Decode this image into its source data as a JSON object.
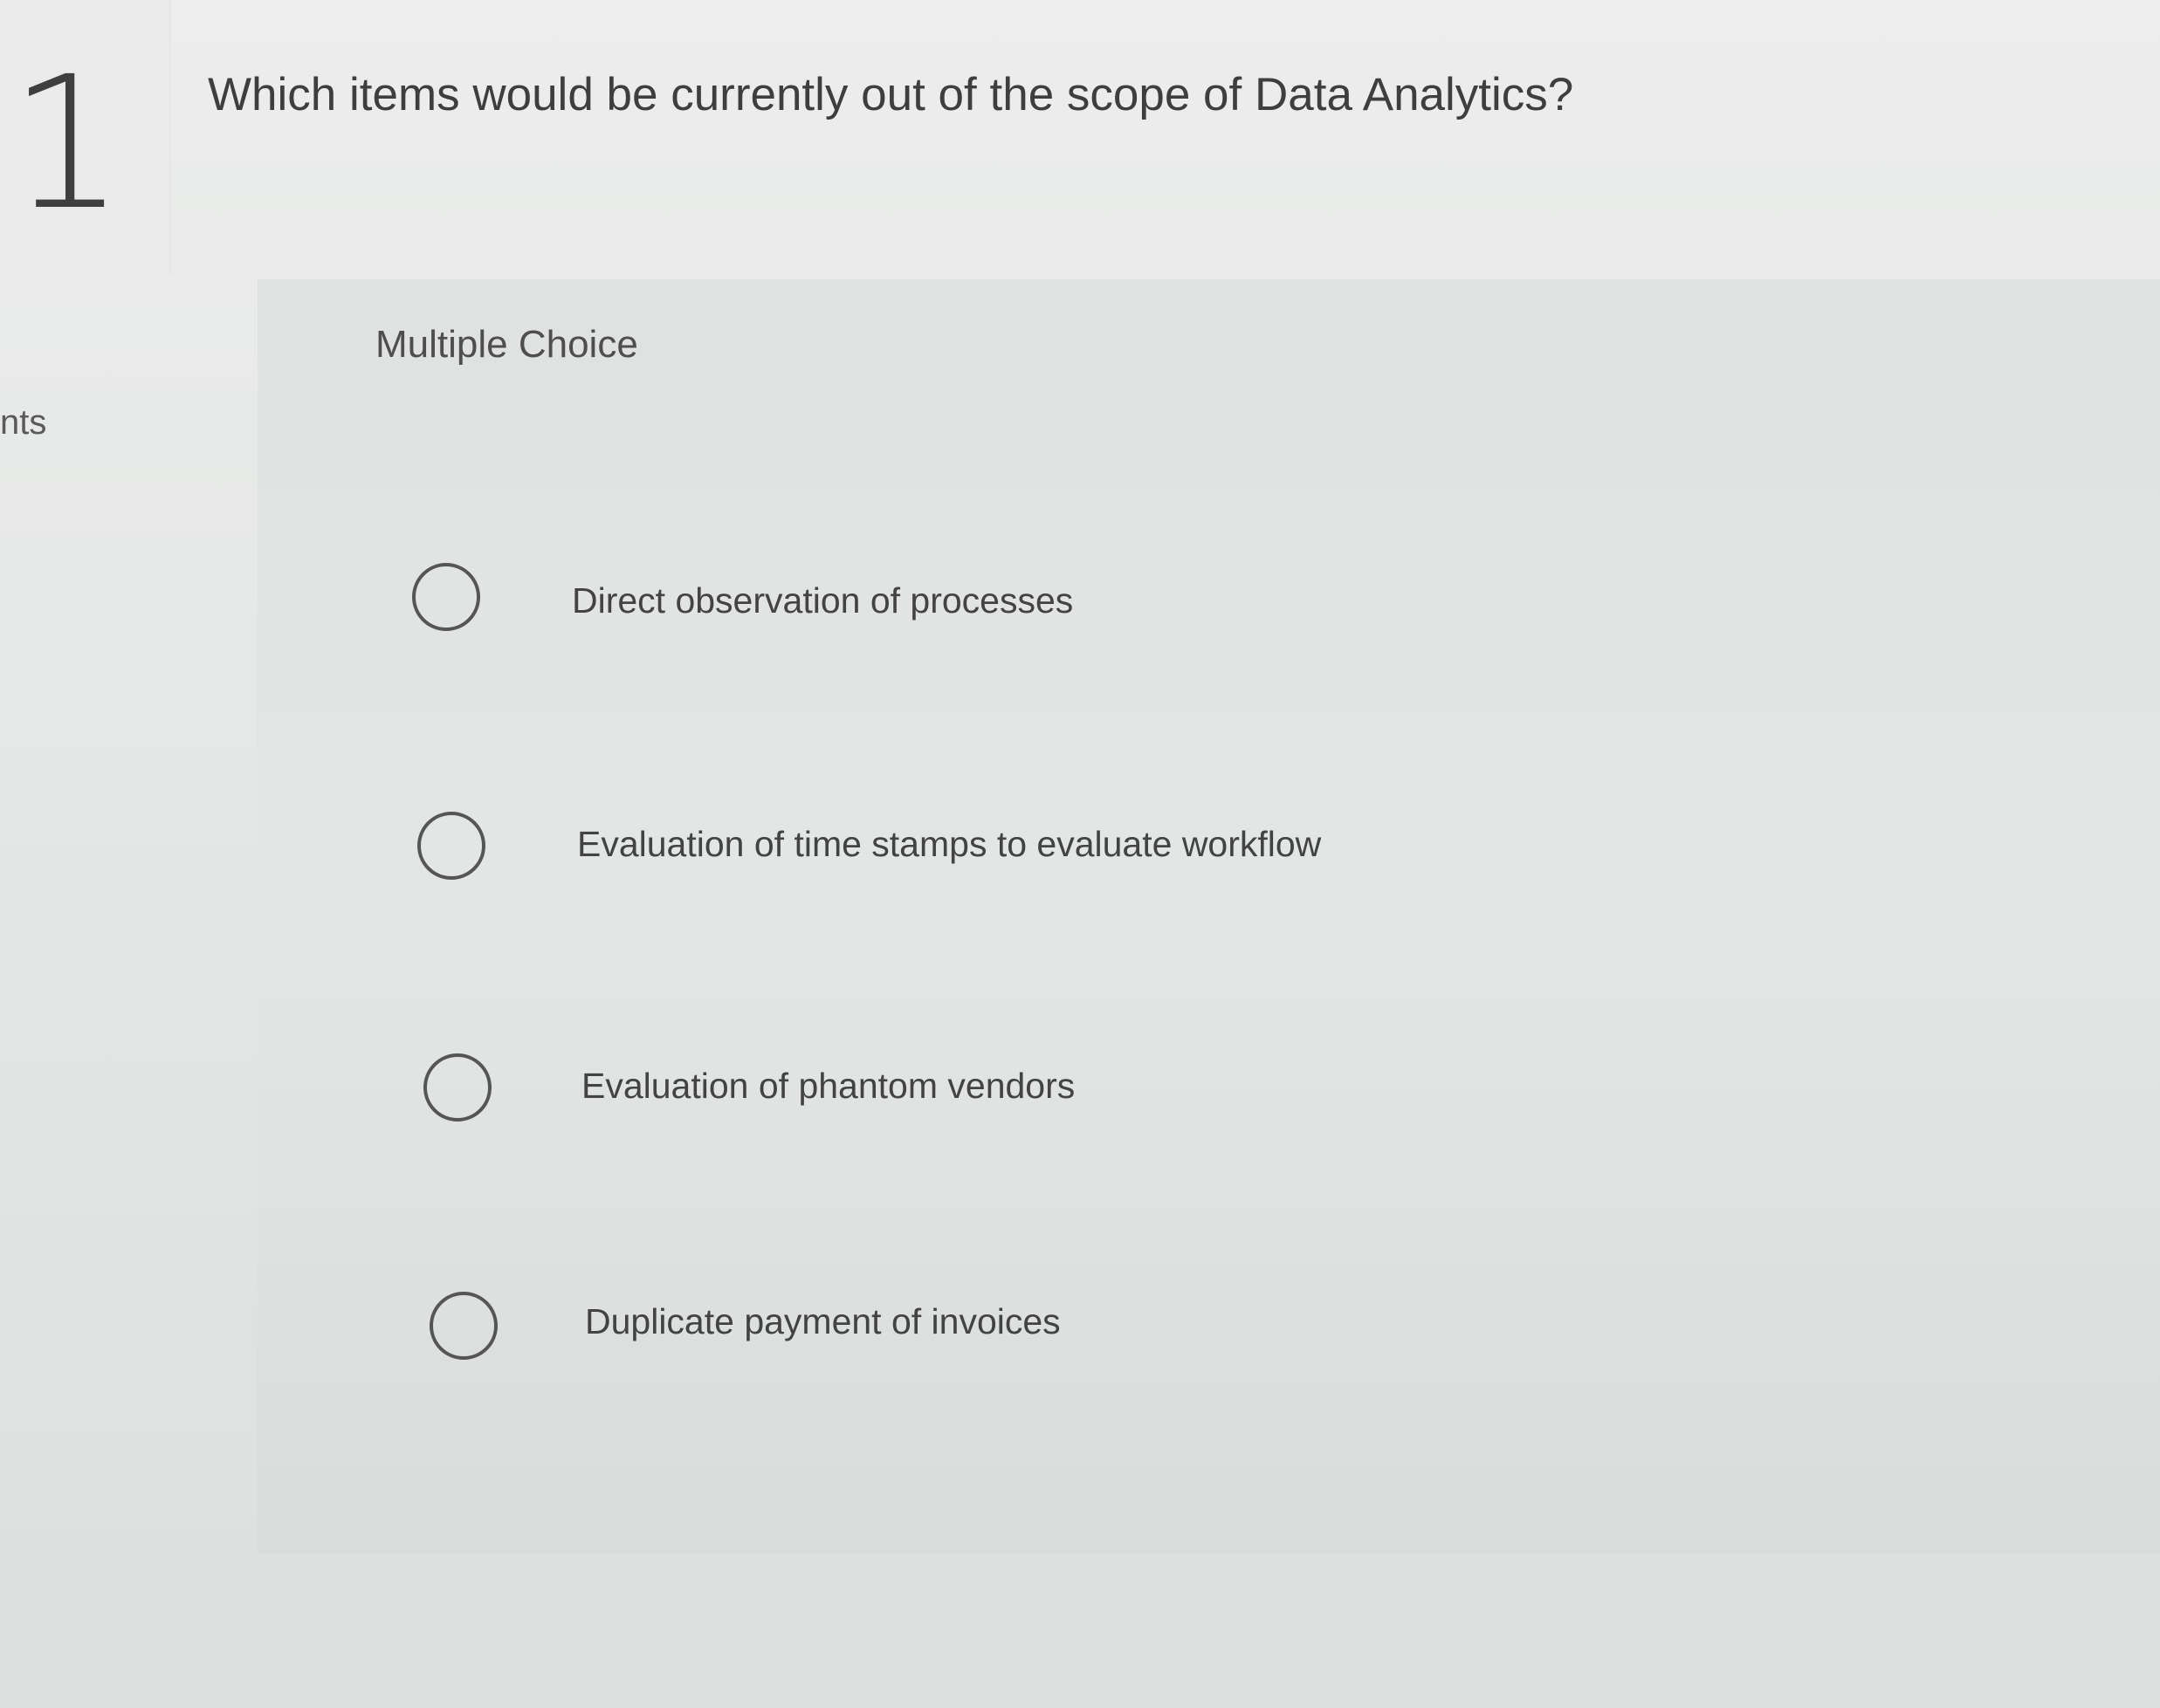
{
  "question": {
    "number": "1",
    "points_label": "nts",
    "text": "Which items would be currently out of the scope of Data Analytics?"
  },
  "answer_area": {
    "type_label": "Multiple Choice",
    "options": [
      {
        "label": "Direct observation of processes",
        "selected": false
      },
      {
        "label": "Evaluation of time stamps to evaluate workflow",
        "selected": false
      },
      {
        "label": "Evaluation of phantom vendors",
        "selected": false
      },
      {
        "label": "Duplicate payment of invoices",
        "selected": false
      }
    ]
  },
  "colors": {
    "background": "#e6e8e7",
    "card": "#e0e3e2",
    "text": "#434343",
    "radio_border": "#555555"
  }
}
